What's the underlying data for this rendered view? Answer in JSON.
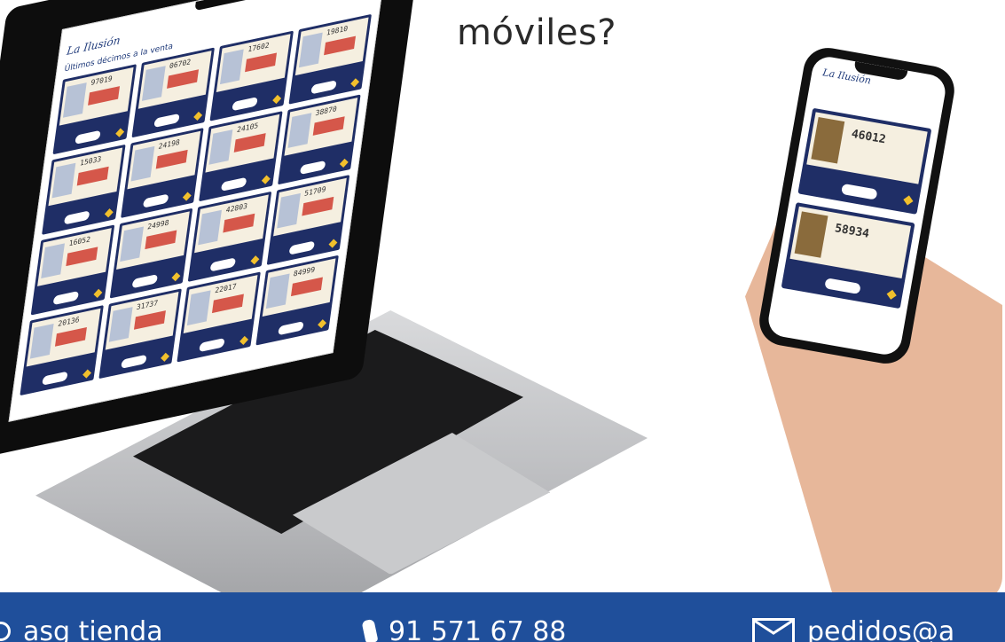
{
  "headline": "móviles?",
  "footer": {
    "item1": "asg tienda",
    "item2": "91 571 67 88",
    "item3": "pedidos@a"
  },
  "laptop_screen": {
    "section_title": "Últimos décimos a la venta",
    "tickets": [
      "97019",
      "06702",
      "17602",
      "19810",
      "15033",
      "24198",
      "24105",
      "38870",
      "16052",
      "24998",
      "42803",
      "51709",
      "20136",
      "31737",
      "22017",
      "84999"
    ]
  },
  "phone_screen": {
    "tickets": [
      "46012",
      "58934"
    ]
  },
  "colors": {
    "footer": "#1f4f9b",
    "ticket_navy": "#1f2e66",
    "ticket_paper": "#f5efe0",
    "accent_gold": "#f2c02c"
  }
}
